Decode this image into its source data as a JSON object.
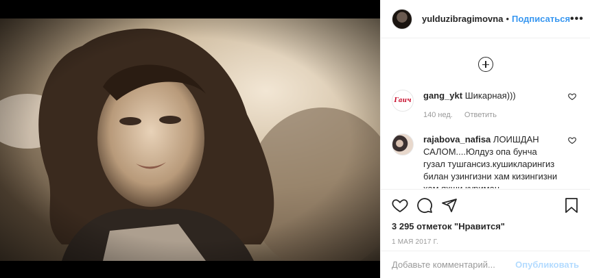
{
  "header": {
    "username": "yulduzibragimovna",
    "separator": "•",
    "follow_label": "Подписаться",
    "more_label": "•••"
  },
  "comments": [
    {
      "username": "gang_ykt",
      "text": "Шикарная)))",
      "time": "140 нед.",
      "reply_label": "Ответить",
      "avatar_text": "Гаич"
    },
    {
      "username": "rajabova_nafisa",
      "text": "ЛОИШДАН САЛОМ....Юлдуз опа бунча гузал тушгансиз.кушикларингиз билан узингизни хам кизингизни хам яхши куриман"
    }
  ],
  "actions": {
    "likes": "3 295 отметок \"Нравится\"",
    "date": "1 мая 2017 г."
  },
  "add_comment": {
    "placeholder": "Добавьте комментарий...",
    "publish_label": "Опубликовать"
  }
}
